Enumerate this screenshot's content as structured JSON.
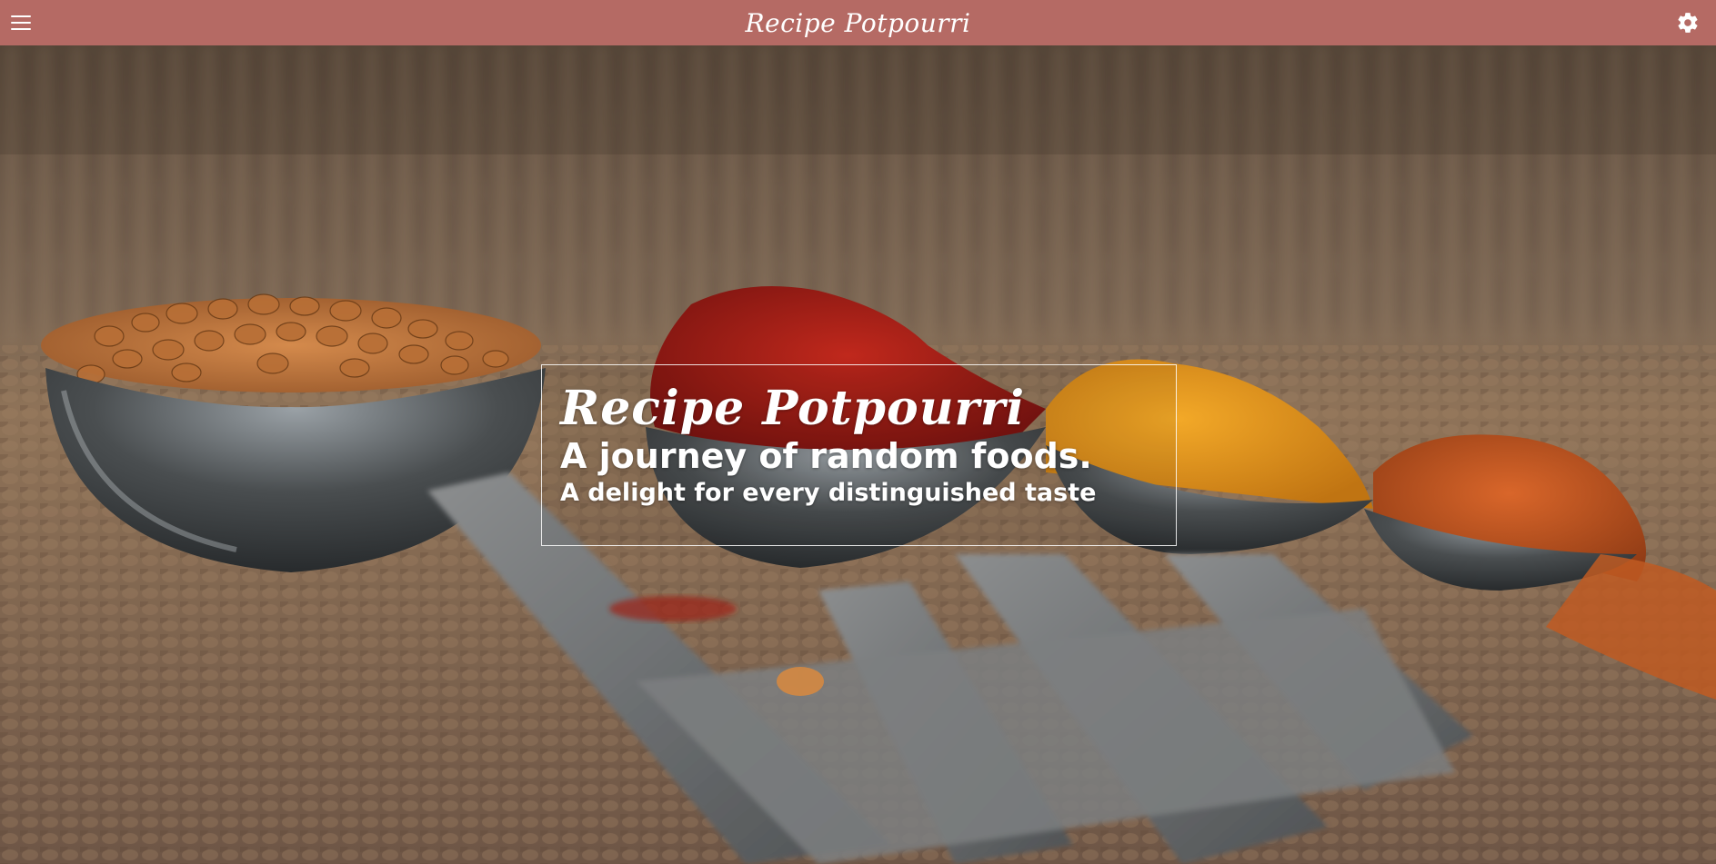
{
  "header": {
    "title": "Recipe Potpourri",
    "menu_icon": "hamburger-menu-icon",
    "settings_icon": "gear-icon",
    "background_color": "#b56a64"
  },
  "hero": {
    "title": "Recipe Potpourri",
    "tagline": "A journey of random foods.",
    "subtagline": "A delight for every distinguished taste",
    "image": "measuring-spoons-with-spices-photo"
  }
}
